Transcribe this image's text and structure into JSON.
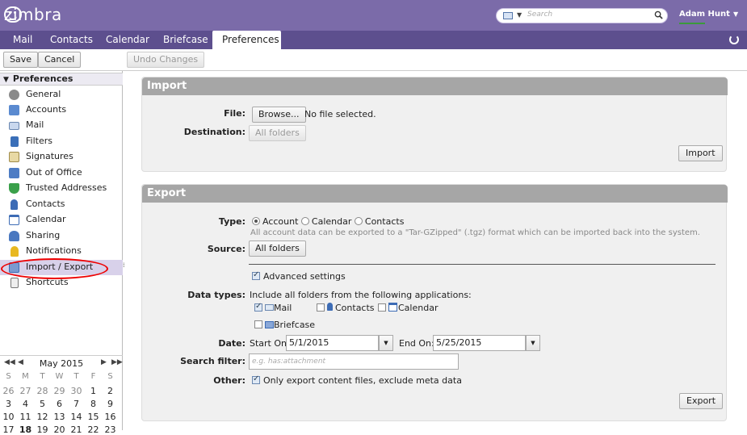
{
  "app": {
    "logo": "zimbra"
  },
  "search": {
    "placeholder": "Search"
  },
  "user": {
    "name": "Adam Hunt"
  },
  "tabs": [
    "Mail",
    "Contacts",
    "Calendar",
    "Briefcase",
    "Preferences"
  ],
  "toolbar": {
    "save": "Save",
    "cancel": "Cancel",
    "undo": "Undo Changes"
  },
  "sidebar": {
    "title": "Preferences",
    "items": [
      "General",
      "Accounts",
      "Mail",
      "Filters",
      "Signatures",
      "Out of Office",
      "Trusted Addresses",
      "Contacts",
      "Calendar",
      "Sharing",
      "Notifications",
      "Import / Export",
      "Shortcuts"
    ],
    "selected": "Import / Export"
  },
  "calendar": {
    "month": "May 2015",
    "dow": [
      "S",
      "M",
      "T",
      "W",
      "T",
      "F",
      "S"
    ],
    "weeks": [
      [
        "26",
        "27",
        "28",
        "29",
        "30",
        "1",
        "2"
      ],
      [
        "3",
        "4",
        "5",
        "6",
        "7",
        "8",
        "9"
      ],
      [
        "10",
        "11",
        "12",
        "13",
        "14",
        "15",
        "16"
      ],
      [
        "17",
        "18",
        "19",
        "20",
        "21",
        "22",
        "23"
      ]
    ]
  },
  "import": {
    "title": "Import",
    "file_label": "File:",
    "browse": "Browse...",
    "no_file": "No file selected.",
    "dest_label": "Destination:",
    "dest_value": "All folders",
    "button": "Import"
  },
  "export": {
    "title": "Export",
    "type_label": "Type:",
    "types": [
      "Account",
      "Calendar",
      "Contacts"
    ],
    "type_hint": "All account data can be exported to a \"Tar-GZipped\" (.tgz) format which can be imported back into the system.",
    "source_label": "Source:",
    "source_value": "All folders",
    "advanced": "Advanced settings",
    "datatypes_label": "Data types:",
    "datatypes_intro": "Include all folders from the following applications:",
    "datatypes": [
      "Mail",
      "Contacts",
      "Calendar",
      "Briefcase"
    ],
    "date_label": "Date:",
    "start_label": "Start On:",
    "start_value": "5/1/2015",
    "end_label": "End On:",
    "end_value": "5/25/2015",
    "search_label": "Search filter:",
    "search_placeholder": "e.g. has:attachment",
    "other_label": "Other:",
    "other_option": "Only export content files, exclude meta data",
    "button": "Export"
  }
}
